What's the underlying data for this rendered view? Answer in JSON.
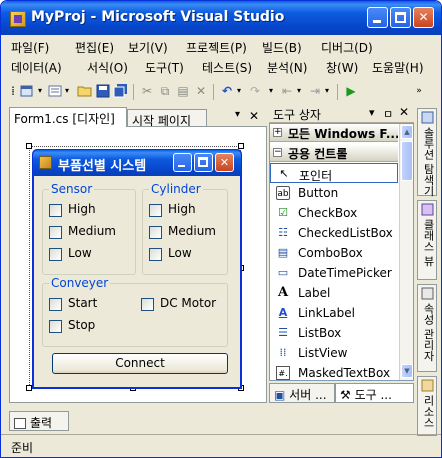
{
  "window": {
    "title": "MyProj - Microsoft Visual Studio",
    "minimize": "_",
    "maximize": "□",
    "close": "✕"
  },
  "menu": {
    "row1": [
      "파일(F)",
      "편집(E)",
      "보기(V)",
      "프로젝트(P)",
      "빌드(B)",
      "디버그(D)"
    ],
    "row2": [
      "데이터(A)",
      "서식(O)",
      "도구(T)",
      "테스트(S)",
      "분석(N)",
      "창(W)",
      "도움말(H)"
    ]
  },
  "doc_tabs": {
    "active": "Form1.cs [디자인]",
    "inactive": "시작 페이지",
    "dropdown": "▾",
    "close": "✕"
  },
  "form": {
    "title": "부품선별 시스템",
    "close": "✕",
    "sensor": {
      "label": "Sensor",
      "items": [
        "High",
        "Medium",
        "Low"
      ]
    },
    "cylinder": {
      "label": "Cylinder",
      "items": [
        "High",
        "Medium",
        "Low"
      ]
    },
    "conveyer": {
      "label": "Conveyer",
      "items": [
        "Start",
        "Stop",
        "DC Motor"
      ]
    },
    "connect": "Connect"
  },
  "toolbox": {
    "title": "도구 상자",
    "pin": "ㅁ",
    "close": "✕",
    "headers": [
      {
        "sign": "+",
        "label": "모든 Windows F..."
      },
      {
        "sign": "−",
        "label": "공용 컨트롤"
      }
    ],
    "items": [
      {
        "label": "포인터",
        "icon": "↖"
      },
      {
        "label": "Button",
        "icon": "ab"
      },
      {
        "label": "CheckBox",
        "icon": "☑"
      },
      {
        "label": "CheckedListBox",
        "icon": "☷"
      },
      {
        "label": "ComboBox",
        "icon": "▤"
      },
      {
        "label": "DateTimePicker",
        "icon": "▭"
      },
      {
        "label": "Label",
        "icon": "A"
      },
      {
        "label": "LinkLabel",
        "icon": "A"
      },
      {
        "label": "ListBox",
        "icon": "☰"
      },
      {
        "label": "ListView",
        "icon": "⁞⁞"
      },
      {
        "label": "MaskedTextBox",
        "icon": "#."
      }
    ],
    "bottom_tabs": [
      "서버 ...",
      "도구 ..."
    ]
  },
  "right_dock": [
    "솔루션 탐색기",
    "클래스 뷰",
    "속성 관리자",
    "리소스"
  ],
  "output_tab": "출력",
  "status": "준비"
}
